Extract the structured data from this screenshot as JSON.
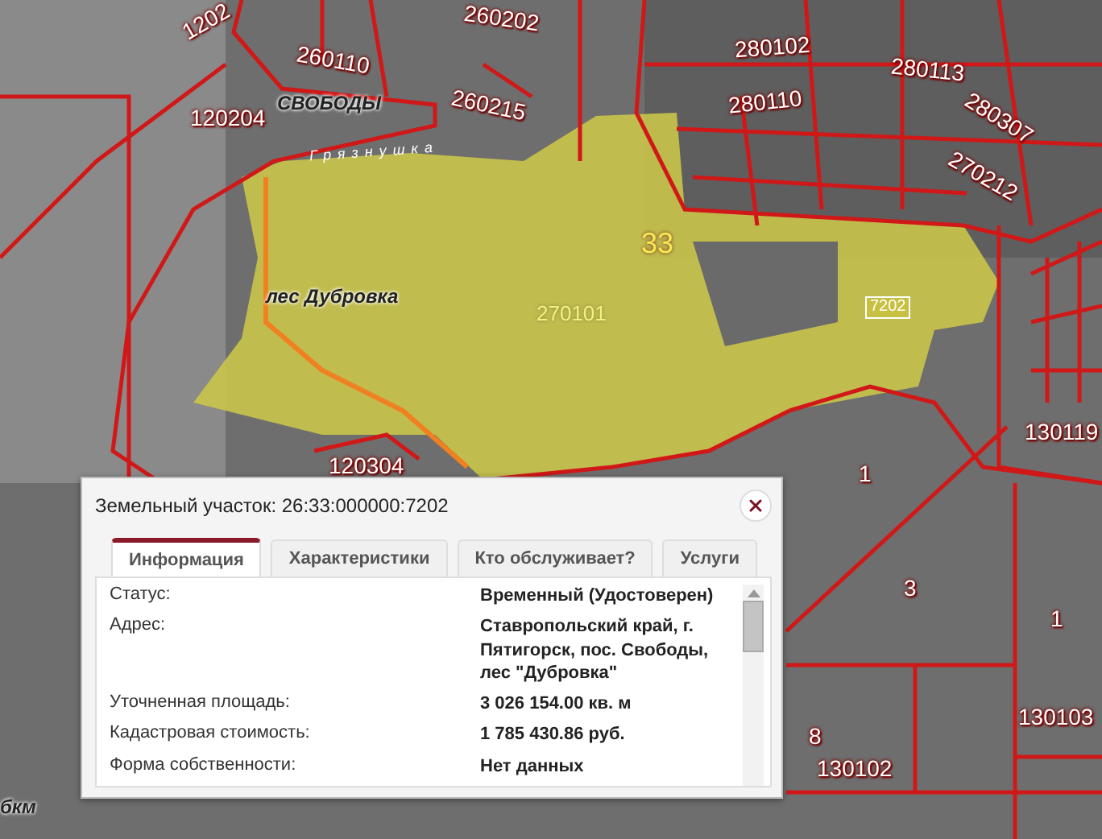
{
  "map": {
    "labels": [
      {
        "text": "1202",
        "kind": "parcel"
      },
      {
        "text": "260202",
        "kind": "parcel"
      },
      {
        "text": "260110",
        "kind": "parcel"
      },
      {
        "text": "280102",
        "kind": "parcel"
      },
      {
        "text": "280113",
        "kind": "parcel"
      },
      {
        "text": "120204",
        "kind": "parcel"
      },
      {
        "text": "СВОБОДЫ",
        "kind": "place"
      },
      {
        "text": "260215",
        "kind": "parcel"
      },
      {
        "text": "280110",
        "kind": "parcel"
      },
      {
        "text": "280307",
        "kind": "parcel"
      },
      {
        "text": "270212",
        "kind": "parcel"
      },
      {
        "text": "Грязнушка",
        "kind": "river"
      },
      {
        "text": "33",
        "kind": "district"
      },
      {
        "text": "лес Дубровка",
        "kind": "place"
      },
      {
        "text": "270101",
        "kind": "block"
      },
      {
        "text": "7202",
        "kind": "tag"
      },
      {
        "text": "130119",
        "kind": "parcel"
      },
      {
        "text": "120304",
        "kind": "parcel"
      },
      {
        "text": "1",
        "kind": "parcel"
      },
      {
        "text": "3",
        "kind": "parcel"
      },
      {
        "text": "1",
        "kind": "parcel"
      },
      {
        "text": "8",
        "kind": "parcel"
      },
      {
        "text": "130102",
        "kind": "parcel"
      },
      {
        "text": "130103",
        "kind": "parcel"
      },
      {
        "text": "бкм",
        "kind": "place"
      }
    ]
  },
  "popup": {
    "title": "Земельный участок: 26:33:000000:7202",
    "tabs": [
      {
        "label": "Информация",
        "selected": true
      },
      {
        "label": "Характеристики",
        "selected": false
      },
      {
        "label": "Кто обслуживает?",
        "selected": false
      },
      {
        "label": "Услуги",
        "selected": false
      }
    ],
    "rows": [
      {
        "label": "Статус:",
        "value": "Временный (Удостоверен)"
      },
      {
        "label": "Адрес:",
        "value": "Ставропольский край, г. Пятигорск, пос. Свободы, лес \"Дубровка\""
      },
      {
        "label": "Уточненная площадь:",
        "value": "3 026 154.00 кв. м"
      },
      {
        "label": "Кадастровая стоимость:",
        "value": "1 785 430.86 руб."
      },
      {
        "label": "Форма собственности:",
        "value": "Нет данных"
      }
    ]
  }
}
